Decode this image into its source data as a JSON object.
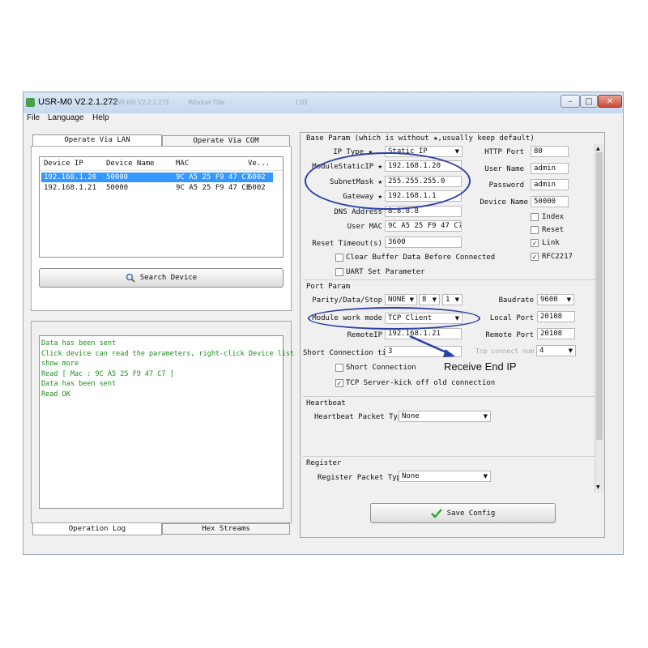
{
  "window": {
    "title": "USR-M0 V2.2.1.272",
    "ghost_text": [
      "USR-M0 V2.2.1.272",
      "Window Title",
      "1.03"
    ],
    "controls": {
      "minimize": "–",
      "maximize": "□",
      "close": "✕"
    }
  },
  "menu": [
    "File",
    "Language",
    "Help"
  ],
  "left": {
    "tabs": [
      "Operate Via LAN",
      "Operate Via COM"
    ],
    "device_table": {
      "columns": [
        "Device IP",
        "Device Name",
        "MAC",
        "Ve..."
      ],
      "rows": [
        [
          "192.168.1.20",
          "50000",
          "9C A5 25 F9 47 C7",
          "6002"
        ],
        [
          "192.168.1.21",
          "50000",
          "9C A5 25 F9 47 CE",
          "6002"
        ]
      ]
    },
    "search_button": "Search Device",
    "log_lines": [
      " Data has been sent",
      "Click device can read the parameters, right-click Device list",
      "show more",
      "Read [ Mac : 9C A5 25 F9 47 C7 ]",
      " Data has been sent",
      "Read OK"
    ],
    "bottom_tabs": [
      "Operation Log",
      "Hex Streams"
    ]
  },
  "base": {
    "header": "Base Param (which is without ★,usually keep default)",
    "ip_type_label": "IP Type",
    "ip_type_value": "Static IP",
    "static_ip_label": "ModuleStaticIP",
    "static_ip_value": "192.168.1.20",
    "subnet_label": "SubnetMask",
    "subnet_value": "255.255.255.0",
    "gateway_label": "Gateway",
    "gateway_value": "192.168.1.1",
    "dns_label": "DNS Address",
    "dns_value": "8.8.8.8",
    "mac_label": "User MAC",
    "mac_value": "9C A5 25 F9 47 C7",
    "reset_label": "Reset Timeout(s)",
    "reset_value": "3600",
    "clear_buffer_label": "Clear Buffer Data Before Connected",
    "uart_label": "UART Set Parameter",
    "http_port_label": "HTTP Port",
    "http_port_value": "80",
    "user_name_label": "User Name",
    "user_name_value": "admin",
    "password_label": "Password",
    "password_value": "admin",
    "device_name_label": "Device Name",
    "device_name_value": "50000",
    "index_label": "Index",
    "reset_chk_label": "Reset",
    "link_label": "Link",
    "rfc_label": "RFC2217",
    "star": "★"
  },
  "port": {
    "header": "Port Param",
    "parity_label": "Parity/Data/Stop",
    "parity_value": "NONE",
    "data_value": "8",
    "stop_value": "1",
    "baud_label": "Baudrate",
    "baud_value": "9600",
    "mode_label": "Module work mode",
    "mode_value": "TCP Client",
    "local_port_label": "Local Port",
    "local_port_value": "20108",
    "remote_ip_label": "RemoteIP",
    "remote_ip_value": "192.168.1.21",
    "remote_port_label": "Remote Port",
    "remote_port_value": "20108",
    "short_time_label": "Short Connection time",
    "short_time_value": "3",
    "tcp_num_label": "Tcp connect num",
    "tcp_num_value": "4",
    "short_conn_label": "Short Connection",
    "kick_label": "TCP Server-kick off old connection"
  },
  "heartbeat": {
    "header": "Heartbeat",
    "label": "Heartbeat Packet Type",
    "value": "None"
  },
  "register": {
    "header": "Register",
    "label": "Register Packet Type",
    "value": "None"
  },
  "save_button": "Save Config",
  "annotation": "Receive End IP",
  "icons": {
    "check": "✓",
    "dropdown": "▼",
    "search": "search-icon",
    "save": "checkmark-icon"
  },
  "colors": {
    "annotation": "#2b3fa8",
    "selected_row": "#3399ff",
    "log_text": "#1c8f1c",
    "save_check": "#3aa83a"
  }
}
